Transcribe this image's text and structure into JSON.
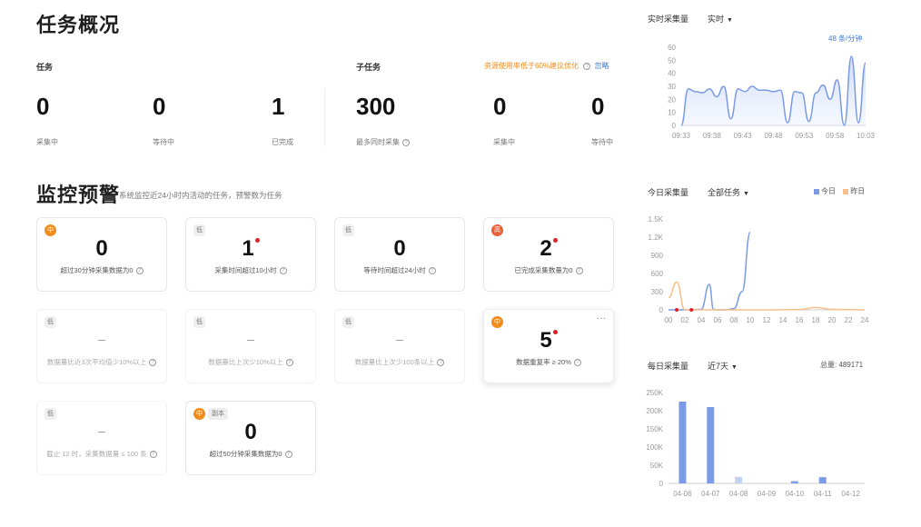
{
  "overview": {
    "title": "任务概况",
    "task_label": "任务",
    "subtask_label": "子任务",
    "tip": "资源使用率低于60%建议优化",
    "ignore": "忽略",
    "tasks": [
      {
        "value": "0",
        "label": "采集中"
      },
      {
        "value": "0",
        "label": "等待中"
      },
      {
        "value": "1",
        "label": "已完成"
      }
    ],
    "subtasks": [
      {
        "value": "300",
        "label": "最多同时采集"
      },
      {
        "value": "0",
        "label": "采集中"
      },
      {
        "value": "0",
        "label": "等待中"
      }
    ]
  },
  "monitor": {
    "title": "监控预警",
    "subtitle": "系统监控近24小时内活动的任务，预警数为任务",
    "cards": [
      {
        "level": "中",
        "value": "0",
        "desc": "超过30分钟采集数据为0",
        "alert": false,
        "dim": false
      },
      {
        "level": "低",
        "value": "1",
        "desc": "采集时间超过10小时",
        "alert": true,
        "dim": false
      },
      {
        "level": "低",
        "value": "0",
        "desc": "等待时间超过24小时",
        "alert": false,
        "dim": false
      },
      {
        "level": "高",
        "value": "2",
        "desc": "已完成采集数量为0",
        "alert": true,
        "dim": false
      },
      {
        "level": "低",
        "value": "–",
        "desc": "数据量比近3次平均值少10%以上",
        "alert": false,
        "dim": true
      },
      {
        "level": "低",
        "value": "–",
        "desc": "数据量比上次少10%以上",
        "alert": false,
        "dim": true
      },
      {
        "level": "低",
        "value": "–",
        "desc": "数据量比上次少100条以上",
        "alert": false,
        "dim": true
      },
      {
        "level": "中",
        "value": "5",
        "desc": "数据重复率 ≥ 20%",
        "alert": true,
        "dim": false,
        "more": "···"
      },
      {
        "level": "低",
        "value": "–",
        "desc": "截止 12 时，采集数据量 ≤ 100 条",
        "alert": false,
        "dim": true
      },
      {
        "level": "中",
        "extra": "副本",
        "value": "0",
        "desc": "超过50分钟采集数据为0",
        "alert": false,
        "dim": false
      }
    ]
  },
  "realtime": {
    "title": "实时采集量",
    "select": "实时",
    "rate": "48 条/分钟"
  },
  "today": {
    "title": "今日采集量",
    "select": "全部任务",
    "legend_today": "今日",
    "legend_yesterday": "昨日"
  },
  "daily": {
    "title": "每日采集量",
    "select": "近7天",
    "total_label": "总量: 489171"
  },
  "colors": {
    "blue": "#7b9be6",
    "orange": "#f5c08a",
    "tip": "#f08c1e",
    "link": "#3b7ddd"
  },
  "chart_data": [
    {
      "type": "area",
      "title": "实时采集量",
      "x": [
        "09:33",
        "09:38",
        "09:43",
        "09:48",
        "09:53",
        "09:58",
        "10:03"
      ],
      "yticks": [
        0,
        10,
        20,
        30,
        40,
        50,
        60
      ],
      "ylim": [
        0,
        60
      ],
      "series": [
        {
          "values": [
            0,
            28,
            26,
            25,
            28,
            22,
            30,
            5,
            28,
            26,
            30,
            27,
            27,
            26,
            27,
            2,
            26,
            25,
            3,
            25,
            31,
            20,
            35,
            0,
            53,
            2,
            48
          ]
        }
      ],
      "grid": false
    },
    {
      "type": "line",
      "title": "今日采集量",
      "x": [
        "00",
        "02",
        "04",
        "06",
        "08",
        "10",
        "12",
        "14",
        "16",
        "18",
        "20",
        "22",
        "24"
      ],
      "yticks": [
        "0",
        "300",
        "600",
        "900",
        "1.2K",
        "1.5K"
      ],
      "ylim": [
        0,
        1500
      ],
      "series": [
        {
          "name": "今日",
          "points": [
            [
              0,
              0
            ],
            [
              1,
              0
            ],
            [
              2,
              0
            ],
            [
              3,
              0
            ],
            [
              4,
              10
            ],
            [
              5,
              420
            ],
            [
              5.5,
              10
            ],
            [
              6,
              0
            ],
            [
              7,
              0
            ],
            [
              8,
              20
            ],
            [
              9,
              300
            ],
            [
              10,
              1280
            ]
          ]
        },
        {
          "name": "昨日",
          "points": [
            [
              0,
              200
            ],
            [
              1,
              460
            ],
            [
              2,
              0
            ],
            [
              4,
              0
            ],
            [
              8,
              0
            ],
            [
              12,
              0
            ],
            [
              16,
              5
            ],
            [
              18,
              40
            ],
            [
              20,
              10
            ],
            [
              22,
              5
            ],
            [
              24,
              0
            ]
          ]
        }
      ]
    },
    {
      "type": "bar",
      "title": "每日采集量",
      "categories": [
        "04-06",
        "04-07",
        "04-08",
        "04-09",
        "04-10",
        "04-11",
        "04-12"
      ],
      "yticks": [
        "0",
        "50K",
        "100K",
        "150K",
        "200K",
        "250K"
      ],
      "ylim": [
        0,
        250000
      ],
      "values": [
        225000,
        210000,
        18000,
        0,
        6000,
        17000,
        0
      ]
    }
  ]
}
